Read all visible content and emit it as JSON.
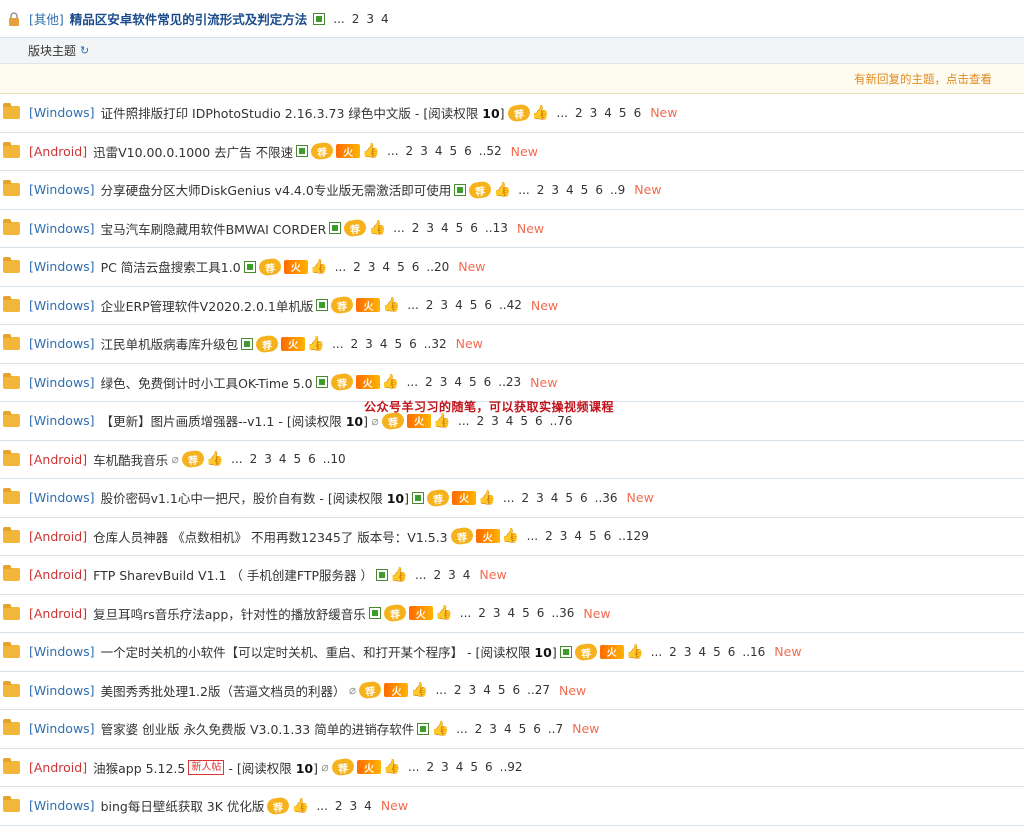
{
  "sticky": {
    "type": "[其他]",
    "title": "精品区安卓软件常见的引流形式及判定方法",
    "pages": [
      "...",
      "2",
      "3",
      "4"
    ]
  },
  "section": {
    "label": "版块主题"
  },
  "notice": {
    "text": "有新回复的主题，点击查看"
  },
  "watermark": "公众号羊习习的随笔，可以获取实操视频课程",
  "threads": [
    {
      "type": "[Windows]",
      "os": "win",
      "title": "证件照排版打印 IDPhotoStudio 2.16.3.73 绿色中文版",
      "tag_pre": " - [阅读权限 ",
      "tag_num": "10",
      "tag_post": "]",
      "icons": [
        "rec",
        "thumb"
      ],
      "pages": [
        "...",
        "2",
        "3",
        "4",
        "5",
        "6"
      ],
      "new": "New"
    },
    {
      "type": "[Android]",
      "os": "and",
      "title": "迅雷V10.00.0.1000 去广告 不限速",
      "icons": [
        "pic",
        "rec",
        "hot",
        "thumb"
      ],
      "pages": [
        "...",
        "2",
        "3",
        "4",
        "5",
        "6",
        "..52"
      ],
      "new": "New"
    },
    {
      "type": "[Windows]",
      "os": "win",
      "title": "分享硬盘分区大师DiskGenius v4.4.0专业版无需激活即可使用",
      "icons": [
        "pic",
        "rec",
        "thumb"
      ],
      "pages": [
        "...",
        "2",
        "3",
        "4",
        "5",
        "6",
        "..9"
      ],
      "new": "New"
    },
    {
      "type": "[Windows]",
      "os": "win",
      "title": "宝马汽车刷隐藏用软件BMWAI CORDER",
      "icons": [
        "pic",
        "rec",
        "thumb"
      ],
      "pages": [
        "...",
        "2",
        "3",
        "4",
        "5",
        "6",
        "..13"
      ],
      "new": "New"
    },
    {
      "type": "[Windows]",
      "os": "win",
      "title": "PC 简洁云盘搜索工具1.0",
      "icons": [
        "pic",
        "rec",
        "hot",
        "thumb"
      ],
      "pages": [
        "...",
        "2",
        "3",
        "4",
        "5",
        "6",
        "..20"
      ],
      "new": "New"
    },
    {
      "type": "[Windows]",
      "os": "win",
      "title": "企业ERP管理软件V2020.2.0.1单机版",
      "icons": [
        "pic",
        "rec",
        "hot",
        "thumb"
      ],
      "pages": [
        "...",
        "2",
        "3",
        "4",
        "5",
        "6",
        "..42"
      ],
      "new": "New"
    },
    {
      "type": "[Windows]",
      "os": "win",
      "title": "江民单机版病毒库升级包",
      "icons": [
        "pic",
        "rec",
        "hot",
        "thumb"
      ],
      "pages": [
        "...",
        "2",
        "3",
        "4",
        "5",
        "6",
        "..32"
      ],
      "new": "New"
    },
    {
      "type": "[Windows]",
      "os": "win",
      "title": "绿色、免费倒计时小工具OK-Time 5.0",
      "icons": [
        "pic",
        "rec",
        "hot",
        "thumb"
      ],
      "pages": [
        "...",
        "2",
        "3",
        "4",
        "5",
        "6",
        "..23"
      ],
      "new": "New"
    },
    {
      "type": "[Windows]",
      "os": "win",
      "title": "【更新】图片画质增强器--v1.1",
      "tag_pre": " - [阅读权限 ",
      "tag_num": "10",
      "tag_post": "]",
      "icons": [
        "clip",
        "rec",
        "hot",
        "thumb"
      ],
      "pages": [
        "...",
        "2",
        "3",
        "4",
        "5",
        "6",
        "..76"
      ],
      "new": ""
    },
    {
      "type": "[Android]",
      "os": "and",
      "title": "车机酷我音乐",
      "icons": [
        "clip",
        "rec",
        "thumb"
      ],
      "pages": [
        "...",
        "2",
        "3",
        "4",
        "5",
        "6",
        "..10"
      ],
      "new": ""
    },
    {
      "type": "[Windows]",
      "os": "win",
      "title": "股价密码v1.1心中一把尺，股价自有数",
      "tag_pre": " - [阅读权限 ",
      "tag_num": "10",
      "tag_post": "]",
      "icons": [
        "pic",
        "rec",
        "hot",
        "thumb"
      ],
      "pages": [
        "...",
        "2",
        "3",
        "4",
        "5",
        "6",
        "..36"
      ],
      "new": "New"
    },
    {
      "type": "[Android]",
      "os": "and",
      "title": "仓库人员神器 《点数相机》 不用再数12345了 版本号：V1.5.3",
      "icons": [
        "rec",
        "hot",
        "thumb"
      ],
      "pages": [
        "...",
        "2",
        "3",
        "4",
        "5",
        "6",
        "..129"
      ],
      "new": ""
    },
    {
      "type": "[Android]",
      "os": "and",
      "title": "FTP SharevBuild V1.1 （ 手机创建FTP服务器 ）",
      "icons": [
        "pic",
        "thumb"
      ],
      "pages": [
        "...",
        "2",
        "3",
        "4"
      ],
      "new": "New"
    },
    {
      "type": "[Android]",
      "os": "and",
      "title": "复旦耳鸣rs音乐疗法app，针对性的播放舒缓音乐",
      "icons": [
        "pic",
        "rec",
        "hot",
        "thumb"
      ],
      "pages": [
        "...",
        "2",
        "3",
        "4",
        "5",
        "6",
        "..36"
      ],
      "new": "New"
    },
    {
      "type": "[Windows]",
      "os": "win",
      "title": "一个定时关机的小软件【可以定时关机、重启、和打开某个程序】",
      "tag_pre": " - [阅读权限 ",
      "tag_num": "10",
      "tag_post": "]",
      "icons": [
        "pic",
        "rec",
        "hot",
        "thumb"
      ],
      "pages": [
        "...",
        "2",
        "3",
        "4",
        "5",
        "6",
        "..16"
      ],
      "new": "New"
    },
    {
      "type": "[Windows]",
      "os": "win",
      "title": "美图秀秀批处理1.2版（苦逼文档员的利器）",
      "icons": [
        "clip",
        "rec",
        "hot",
        "thumb"
      ],
      "pages": [
        "...",
        "2",
        "3",
        "4",
        "5",
        "6",
        "..27"
      ],
      "new": "New"
    },
    {
      "type": "[Windows]",
      "os": "win",
      "title": "管家婆 创业版 永久免费版 V3.0.1.33 简单的进销存软件",
      "icons": [
        "pic",
        "thumb"
      ],
      "pages": [
        "...",
        "2",
        "3",
        "4",
        "5",
        "6",
        "..7"
      ],
      "new": "New"
    },
    {
      "type": "[Android]",
      "os": "and",
      "title": "油猴app 5.12.5",
      "badge": "新人帖",
      "tag_pre": " - [阅读权限 ",
      "tag_num": "10",
      "tag_post": "]",
      "icons": [
        "clip",
        "rec",
        "hot",
        "thumb"
      ],
      "pages": [
        "...",
        "2",
        "3",
        "4",
        "5",
        "6",
        "..92"
      ],
      "new": ""
    },
    {
      "type": "[Windows]",
      "os": "win",
      "title": "bing每日壁纸获取 3K 优化版",
      "icons": [
        "rec",
        "thumb"
      ],
      "pages": [
        "...",
        "2",
        "3",
        "4"
      ],
      "new": "New"
    }
  ]
}
